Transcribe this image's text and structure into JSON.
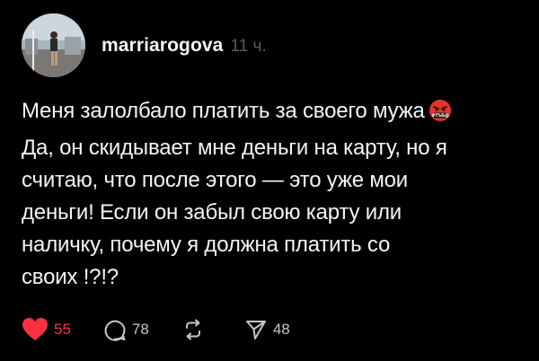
{
  "post": {
    "username": "marriarogova",
    "timestamp": "11 ч.",
    "text_lines": [
      "Меня залолбало платить за своего мужа",
      "Да, он скидывает мне деньги на карту, но я",
      "считаю, что после этого — это уже мои",
      "деньги! Если он забыл свою карту или",
      "наличку, почему я должна платить со",
      "своих !?!?"
    ],
    "emoji": "angry-face-with-symbols-icon"
  },
  "actions": {
    "likes": "55",
    "replies": "78",
    "reposts": "",
    "shares": "48"
  },
  "colors": {
    "background": "#000000",
    "text": "#f3f5f7",
    "muted": "#5a5a5a",
    "like": "#ff3040",
    "emoji_red": "#e0342c"
  }
}
